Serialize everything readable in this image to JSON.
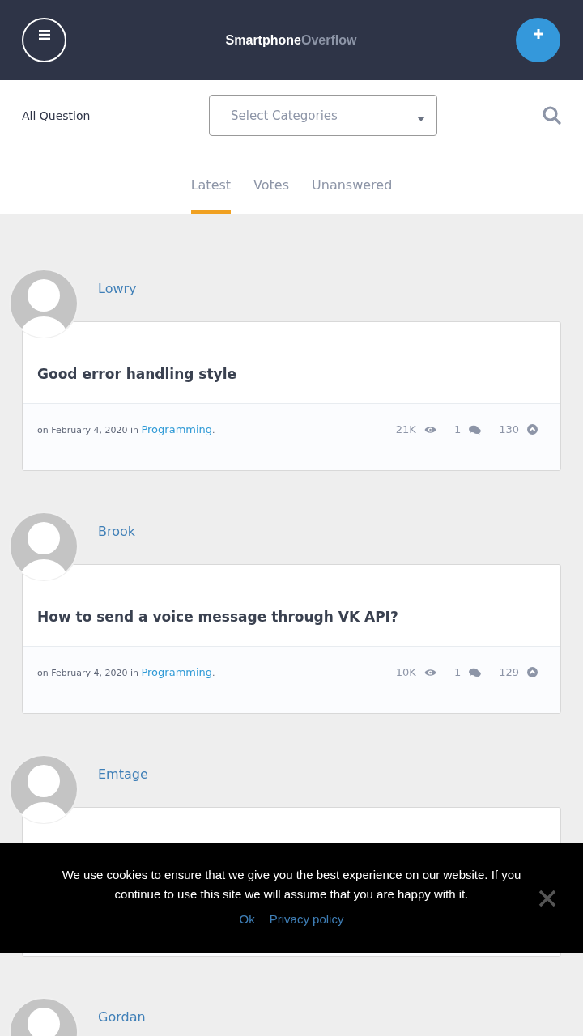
{
  "header": {
    "brand_primary": "Smartphone",
    "brand_secondary": "Overflow"
  },
  "filter_bar": {
    "label": "All Question",
    "category_select": {
      "placeholder": "Select Categories"
    }
  },
  "tabs": [
    {
      "label": "Latest",
      "selected": true
    },
    {
      "label": "Votes",
      "selected": false
    },
    {
      "label": "Unanswered",
      "selected": false
    }
  ],
  "questions": [
    {
      "author": "Lowry",
      "title": "Good error handling style",
      "date": "on February 4, 2020 in",
      "category": "Programming",
      "end_mark": ".",
      "views": "21K",
      "answers": "1",
      "votes": "130"
    },
    {
      "author": "Brook",
      "title": "How to send a voice message through VK API?",
      "date": "on February 4, 2020 in",
      "category": "Programming",
      "end_mark": ".",
      "views": "10K",
      "answers": "1",
      "votes": "129"
    },
    {
      "author": "Emtage"
    },
    {
      "author": "Gordan"
    }
  ],
  "cookie_notice": {
    "message": "We use cookies to ensure that we give you the best experience on our website. If you continue to use this site we will assume that you are happy with it.",
    "ok": "Ok",
    "privacy": "Privacy policy"
  }
}
